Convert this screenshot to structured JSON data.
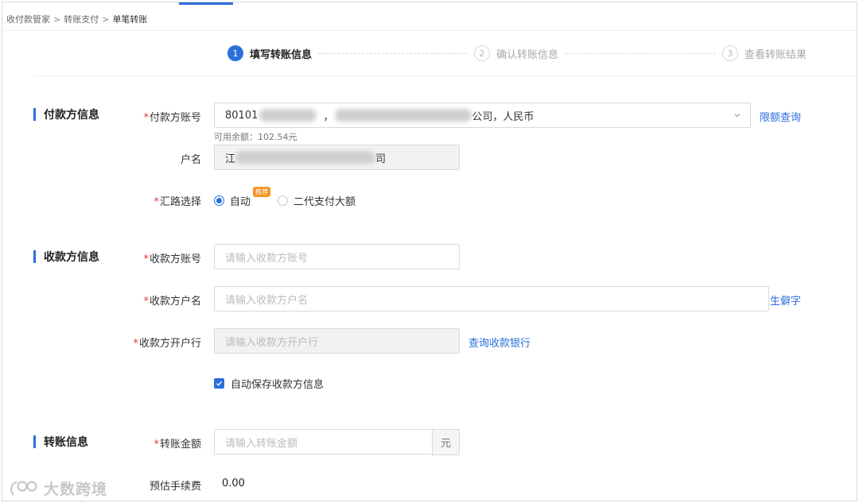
{
  "breadcrumb": {
    "items": [
      "收付款管家",
      "转账支付",
      "单笔转账"
    ],
    "separator": ">"
  },
  "steps": [
    {
      "number": "1",
      "label": "填写转账信息",
      "state": "active"
    },
    {
      "number": "2",
      "label": "确认转账信息",
      "state": "inactive"
    },
    {
      "number": "3",
      "label": "查看转账结果",
      "state": "inactive"
    }
  ],
  "payer": {
    "section_title": "付款方信息",
    "account": {
      "label": "付款方账号",
      "value_prefix": "80101",
      "value_mid": "，",
      "value_suffix": "公司，人民币",
      "limit_link": "限额查询"
    },
    "available_balance": "可用余额：102.54元",
    "account_name": {
      "label": "户名",
      "value_prefix": "江",
      "value_suffix": "司"
    },
    "route": {
      "label": "汇路选择",
      "options": [
        {
          "label": "自动",
          "checked": true,
          "badge": "推荐"
        },
        {
          "label": "二代支付大额",
          "checked": false
        }
      ]
    }
  },
  "payee": {
    "section_title": "收款方信息",
    "account": {
      "label": "收款方账号",
      "placeholder": "请输入收款方账号"
    },
    "name": {
      "label": "收款方户名",
      "placeholder": "请输入收款方户名",
      "link": "生僻字"
    },
    "bank": {
      "label": "收款方开户行",
      "placeholder": "请输入收款方开户行",
      "link": "查询收款银行"
    },
    "auto_save": {
      "label": "自动保存收款方信息",
      "checked": true
    }
  },
  "transfer": {
    "section_title": "转账信息",
    "amount": {
      "label": "转账金额",
      "placeholder": "请输入转账金额",
      "unit": "元"
    },
    "fee": {
      "label": "预估手续费",
      "value": "0.00"
    }
  },
  "watermark": "大数跨境",
  "colors": {
    "accent": "#2a6fdb",
    "required": "#e4393c",
    "badge": "#f49523"
  }
}
